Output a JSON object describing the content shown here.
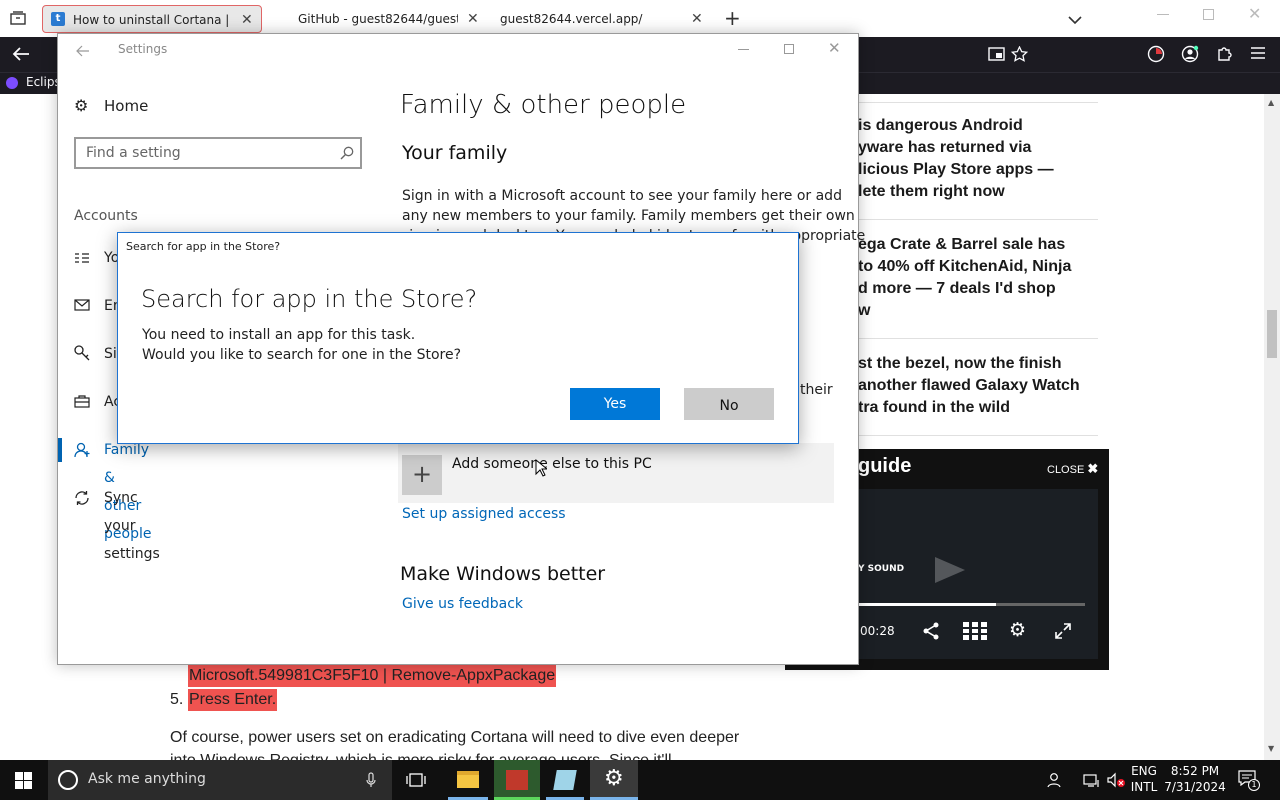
{
  "browser": {
    "tabs": [
      {
        "label": "How to uninstall Cortana | Tom's",
        "active": true
      },
      {
        "label": "GitHub - guest82644/guest82644"
      },
      {
        "label": "guest82644.vercel.app/"
      }
    ],
    "bookmark_label": "Eclips"
  },
  "article": {
    "sidebar_headlines": [
      [
        "is dangerous Android",
        "yware has returned via",
        "licious Play Store apps —",
        "lete them right now"
      ],
      [
        "ega Crate & Barrel sale has",
        "to 40% off KitchenAid, Ninja",
        "d more — 7 deals I'd shop",
        "w"
      ],
      [
        "st the bezel, now the finish",
        "another flawed Galaxy Watch",
        "tra found in the wild"
      ]
    ],
    "video": {
      "brand": "guide",
      "close_label": "CLOSE",
      "sound_label": "Y SOUND",
      "time": "00:28",
      "progress": 0.61
    },
    "code_line": "Microsoft.549981C3F5F10 | Remove-AppxPackage",
    "step_number": "5.",
    "step_text": "Press Enter.",
    "body_line1": "Of course, power users set on eradicating Cortana will need to dive even deeper",
    "body_line2": "into Windows Registry, which is more risky for average users. Since it'll"
  },
  "settings": {
    "title": "Settings",
    "home_label": "Home",
    "search_placeholder": "Find a setting",
    "section_label": "Accounts",
    "nav": [
      {
        "label": "Yo",
        "icon": "person-card-icon"
      },
      {
        "label": "Em",
        "icon": "mail-icon"
      },
      {
        "label": "Si",
        "icon": "key-icon"
      },
      {
        "label": "Ac",
        "icon": "briefcase-icon"
      },
      {
        "label": "Family & other people",
        "icon": "person-icon",
        "selected": true
      },
      {
        "label": "Sync your settings",
        "icon": "sync-icon"
      }
    ],
    "page_title": "Family & other people",
    "family_heading": "Your family",
    "family_text_1": "Sign in with a Microsoft account to see your family here or add",
    "family_text_2": "any new members to your family. Family members get their own",
    "family_text_3": "sign-ins and desktop. You can help kids stay safe with appropriate",
    "partial_right": "their",
    "add_someone_label": "Add someone else to this PC",
    "assigned_access_link": "Set up assigned access",
    "better_heading": "Make Windows better",
    "feedback_link": "Give us feedback"
  },
  "dialog": {
    "caption": "Search for app in the Store?",
    "heading": "Search for app in the Store?",
    "line1": "You need to install an app for this task.",
    "line2": "Would you like to search for one in the Store?",
    "yes_label": "Yes",
    "no_label": "No"
  },
  "taskbar": {
    "search_placeholder": "Ask me anything",
    "lang_1": "ENG",
    "lang_2": "INTL",
    "time": "8:52 PM",
    "date": "7/31/2024",
    "notification_count": "1"
  },
  "colors": {
    "accent": "#0063b1",
    "link": "#0067b8",
    "yes_button": "#0078d7",
    "no_button": "#cccccc",
    "highlight_red": "#ef5350",
    "browser_dark": "#1c1b22"
  }
}
